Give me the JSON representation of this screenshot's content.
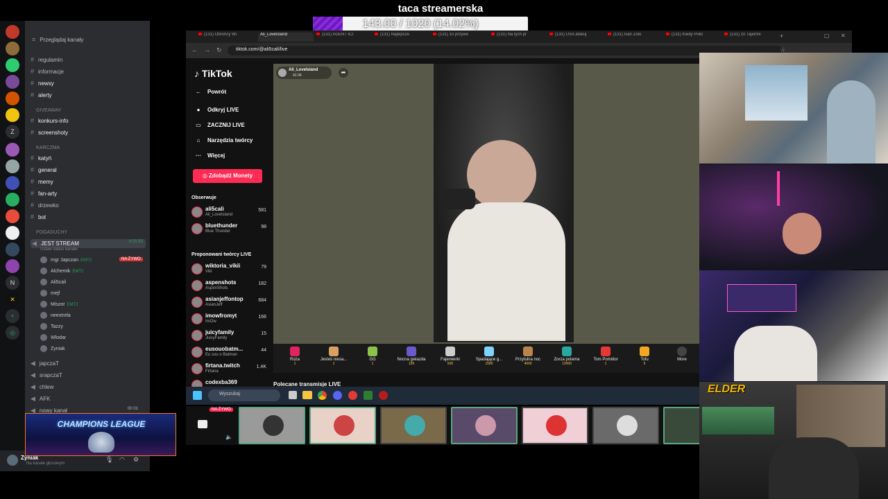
{
  "goal": {
    "title": "taca streamerska",
    "progress_text": "143.00 / 1020 (14.02%)",
    "progress_fraction": 0.1402
  },
  "discord": {
    "browse_channels": "Przeglądaj kanały",
    "channels": [
      {
        "name": "regulamin",
        "style": "dim"
      },
      {
        "name": "informacje",
        "style": "dim"
      },
      {
        "name": "newsy",
        "style": "bright"
      },
      {
        "name": "alerty",
        "style": "bright"
      }
    ],
    "cat_giveaway": "GIVEAWAY",
    "giveaway_channels": [
      "konkurs-info",
      "screenshoty"
    ],
    "cat_karczma": "KARCZMA",
    "karczma_channels": [
      "katyń",
      "general",
      "memy",
      "fan-arty",
      "drzewko",
      "bot"
    ],
    "cat_pogaduchy": "POGADUCHY",
    "voice_channel": "JEST STREAM",
    "voice_timer": "6:25:53",
    "voice_status": "Ustaw status kanału",
    "voice_users": [
      {
        "name": "mgr Japczan",
        "tag": "EMT2",
        "live": true
      },
      {
        "name": "Alchemik",
        "tag": "EMT2",
        "live": false
      },
      {
        "name": "Ali5cali",
        "tag": "",
        "live": false
      },
      {
        "name": "mejf",
        "tag": "",
        "live": false
      },
      {
        "name": "Miszor",
        "tag": "EMT2",
        "live": false
      },
      {
        "name": "neextrela",
        "tag": "",
        "live": false
      },
      {
        "name": "Tazzy",
        "tag": "",
        "live": false
      },
      {
        "name": "Wlodar",
        "tag": "",
        "live": false
      },
      {
        "name": "Zyniak",
        "tag": "",
        "live": false
      }
    ],
    "live_badge": "NA ŻYWO",
    "other_voice": [
      "japczaT",
      "srapczaT",
      "chlew",
      "AFK",
      "nowy kanał"
    ],
    "other_voice_count": "00  01",
    "user_name": "Zyniak",
    "user_status": "Na kanale głosowym"
  },
  "cl_overlay": {
    "text": "CHAMPIONS LEAGUE"
  },
  "browser": {
    "tabs": [
      {
        "label": "(131) Obrońcy Wi"
      },
      {
        "label": "Ali_LoveIsland",
        "active": true
      },
      {
        "label": "(131) AGENT ICI"
      },
      {
        "label": "(131) Najlepsze"
      },
      {
        "label": "(131) 10 przywó"
      },
      {
        "label": "(131) Na tych pr"
      },
      {
        "label": "(131) USA atakuj"
      },
      {
        "label": "(131) Ivan Zolo"
      },
      {
        "label": "(131) Kiedy Polic"
      },
      {
        "label": "(131) 10 Tajemni"
      }
    ],
    "url": "tiktok.com/@ali5cali/live"
  },
  "tiktok": {
    "logo": "TikTok",
    "nav": [
      {
        "icon": "←",
        "label": "Powrót"
      },
      {
        "icon": "●",
        "label": "Odkryj LIVE"
      },
      {
        "icon": "▭",
        "label": "ZACZNIJ LIVE"
      },
      {
        "icon": "⌂",
        "label": "Narzędzia twórcy"
      },
      {
        "icon": "···",
        "label": "Więcej"
      }
    ],
    "coins_button": "Zdobądź Monety",
    "following_title": "Obserwuje",
    "following": [
      {
        "name": "ali5cali",
        "sub": "Ali_LoveIsland",
        "count": "581"
      },
      {
        "name": "bluethunder",
        "sub": "Blue Thunder",
        "count": "98"
      }
    ],
    "suggested_title": "Proponowani twórcy LIVE",
    "suggested": [
      {
        "name": "wiktoria_vikii",
        "sub": "Viki",
        "count": "79"
      },
      {
        "name": "aspenshots",
        "sub": "AspenShots",
        "count": "182"
      },
      {
        "name": "asianjeffontop",
        "sub": "AsianJeff",
        "count": "684"
      },
      {
        "name": "imowfromyt",
        "sub": "ImOw",
        "count": "166"
      },
      {
        "name": "juicyfamily",
        "sub": "JuicyFamily",
        "count": "15"
      },
      {
        "name": "eusouobatm...",
        "sub": "Eu sou o Batman",
        "count": "44"
      },
      {
        "name": "firtana.twitch",
        "sub": "Firtana",
        "count": "1.4K"
      },
      {
        "name": "codexba369",
        "sub": "",
        "count": ""
      }
    ],
    "host": {
      "name": "Ali_LoveIsland",
      "viewers": "42.0K"
    },
    "gifts": [
      {
        "name": "Róża",
        "price": "1",
        "color": "#e0245e"
      },
      {
        "name": "Jesteś niesa...",
        "price": "1",
        "color": "#d9a066"
      },
      {
        "name": "GG",
        "price": "1",
        "color": "#8bc34a"
      },
      {
        "name": "Nocna gwiazda",
        "price": "199",
        "color": "#6a5acd"
      },
      {
        "name": "Fajerwerki",
        "price": "500",
        "color": "#cccccc"
      },
      {
        "name": "Spadające g...",
        "price": "1580",
        "color": "#7fd3ff"
      },
      {
        "name": "Przytulna noc",
        "price": "4000",
        "color": "#b8864b"
      },
      {
        "name": "Zorza polarna",
        "price": "12000",
        "color": "#2aa7a0"
      },
      {
        "name": "Tom Pomidor",
        "price": "1",
        "color": "#e53935"
      },
      {
        "name": "Tofu",
        "price": "5",
        "color": "#f5a623"
      }
    ],
    "gifts_more": "More",
    "recommended_title": "Polecane transmisje LIVE"
  },
  "taskbar": {
    "search_placeholder": "Wyszukaj"
  },
  "cards": {
    "live_label": "NA ŻYWO"
  },
  "webcam": {
    "logo": "ELDER"
  }
}
